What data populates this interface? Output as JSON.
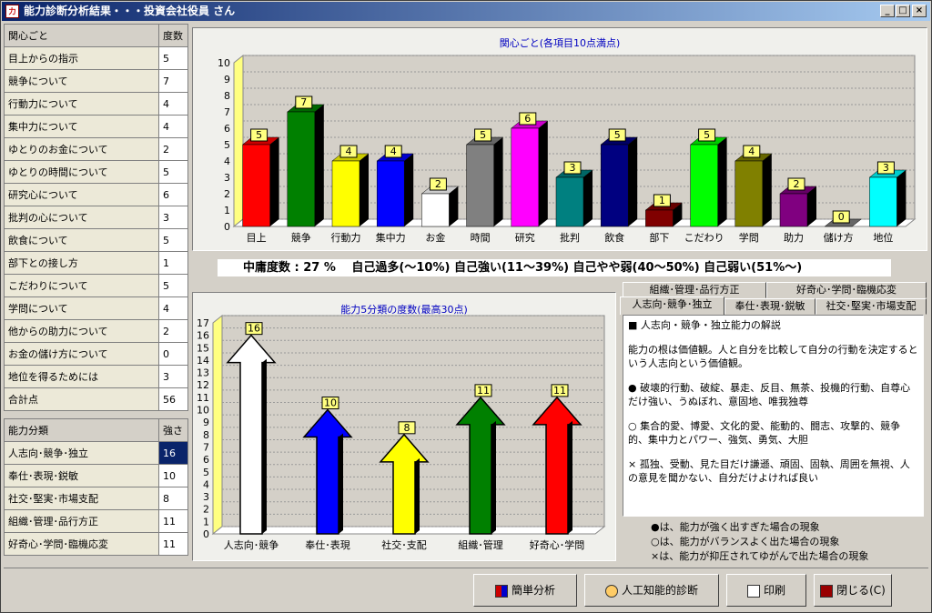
{
  "window": {
    "title": "能力診断分析結果・・・投資会社役員 さん"
  },
  "interest_table": {
    "header": [
      "関心ごと",
      "度数"
    ],
    "rows": [
      [
        "目上からの指示",
        "5"
      ],
      [
        "競争について",
        "7"
      ],
      [
        "行動力について",
        "4"
      ],
      [
        "集中力について",
        "4"
      ],
      [
        "ゆとりのお金について",
        "2"
      ],
      [
        "ゆとりの時間について",
        "5"
      ],
      [
        "研究心について",
        "6"
      ],
      [
        "批判の心について",
        "3"
      ],
      [
        "飲食について",
        "5"
      ],
      [
        "部下との接し方",
        "1"
      ],
      [
        "こだわりについて",
        "5"
      ],
      [
        "学問について",
        "4"
      ],
      [
        "他からの助力について",
        "2"
      ],
      [
        "お金の儲け方について",
        "0"
      ],
      [
        "地位を得るためには",
        "3"
      ],
      [
        "合計点",
        "56"
      ]
    ]
  },
  "ability_table": {
    "header": [
      "能力分類",
      "強さ"
    ],
    "rows": [
      [
        "人志向･競争･独立",
        "16"
      ],
      [
        "奉仕･表現･鋭敏",
        "10"
      ],
      [
        "社交･堅実･市場支配",
        "8"
      ],
      [
        "組織･管理･品行方正",
        "11"
      ],
      [
        "好奇心･学問･臨機応変",
        "11"
      ]
    ]
  },
  "balance_line": "中庸度数 : 27 %　 自己過多(～10%) 自己強い(11～39%) 自己やや弱(40～50%) 自己弱い(51%～)",
  "tabs": {
    "row_back": [
      "組織･管理･品行方正",
      "好奇心･学問･臨機応変"
    ],
    "row_front": [
      "人志向･競争･独立",
      "奉仕･表現･鋭敏",
      "社交･堅実･市場支配"
    ]
  },
  "explanation": {
    "heading": "■ 人志向・競争・独立能力の解説",
    "p1": "能力の根は価値観。人と自分を比較して自分の行動を決定するという人志向という価値観。",
    "p2": "● 破壊的行動、破綻、暴走、反目、無茶、投機的行動、自尊心だけ強い、うぬぼれ、意固地、唯我独尊",
    "p3": "○ 集合的愛、博愛、文化的愛、能動的、闘志、攻撃的、競争的、集中力とパワー、強気、勇気、大胆",
    "p4": "× 孤独、受動、見た目だけ謙遜、頑固、固執、周囲を無視、人の意見を聞かない、自分だけよければ良い"
  },
  "legend": [
    "●は、能力が強く出すぎた場合の現象",
    "○は、能力がバランスよく出た場合の現象",
    "×は、能力が抑圧されてゆがんで出た場合の現象"
  ],
  "buttons": {
    "simple": "簡単分析",
    "ai": "人工知能的診断",
    "print": "印刷",
    "close": "閉じる(C)"
  },
  "chart_data": [
    {
      "type": "bar",
      "title": "関心ごと(各項目10点満点)",
      "categories": [
        "目上",
        "競争",
        "行動力",
        "集中力",
        "お金",
        "時間",
        "研究",
        "批判",
        "飲食",
        "部下",
        "こだわり",
        "学問",
        "助力",
        "儲け方",
        "地位"
      ],
      "values": [
        5,
        7,
        4,
        4,
        2,
        5,
        6,
        3,
        5,
        1,
        5,
        4,
        2,
        0,
        3
      ],
      "colors": [
        "#ff0000",
        "#008000",
        "#ffff00",
        "#0000ff",
        "#ffffff",
        "#808080",
        "#ff00ff",
        "#008080",
        "#000080",
        "#800000",
        "#00ff00",
        "#808000",
        "#800080",
        "#808080",
        "#00ffff"
      ],
      "ylim": [
        0,
        10
      ],
      "grid": true
    },
    {
      "type": "bar",
      "title": "能力5分類の度数(最高30点)",
      "categories": [
        "人志向･競争",
        "奉仕･表現",
        "社交･支配",
        "組織･管理",
        "好奇心･学問"
      ],
      "values": [
        16,
        10,
        8,
        11,
        11
      ],
      "colors": [
        "#ffffff",
        "#0000ff",
        "#ffff00",
        "#008000",
        "#ff0000"
      ],
      "ylim": [
        0,
        17
      ],
      "grid": true
    }
  ]
}
